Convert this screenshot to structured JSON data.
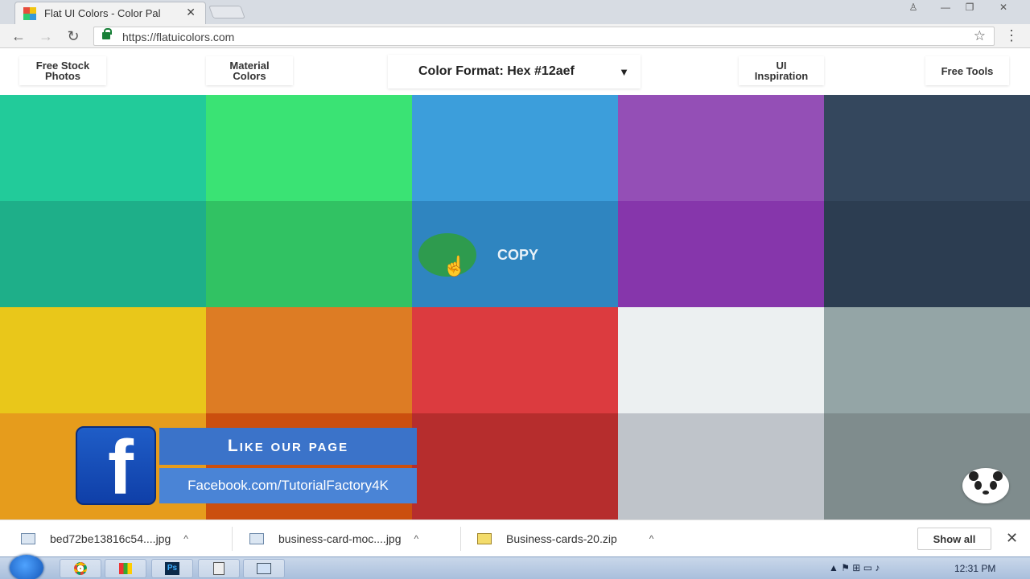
{
  "browser": {
    "tab_title": "Flat UI Colors - Color Pal",
    "tab_close": "✕",
    "url": "https://flatuicolors.com",
    "back": "←",
    "forward": "→",
    "reload": "↻",
    "star": "☆",
    "menu": "⋮",
    "window_controls": [
      "♙",
      "—",
      "❐",
      "✕"
    ]
  },
  "site_nav": {
    "free_stock_photos": [
      "Free Stock",
      "Photos"
    ],
    "material_colors": [
      "Material",
      "Colors"
    ],
    "color_format": "Color Format: Hex #12aef",
    "caret": "▼",
    "ui_inspiration": [
      "UI",
      "Inspiration"
    ],
    "free_tools": "Free Tools"
  },
  "swatches": [
    [
      "#22cb9a",
      "#3ae374",
      "#3c9edb",
      "#944fb6",
      "#34475d"
    ],
    [
      "#1eaf89",
      "#31c263",
      "#2f85c0",
      "#8636ab",
      "#2c3d51"
    ],
    [
      "#e9c71a",
      "#dd7c24",
      "#dc3b3f",
      "#ecf0f1",
      "#94a5a6"
    ],
    [
      "#e69c1c",
      "#cb4f0e",
      "#b62d2d",
      "#bfc4ca",
      "#7f8c8d"
    ]
  ],
  "copy_overlay": {
    "label": "COPY"
  },
  "facebook_banner": {
    "logo_letter": "f",
    "headline": "Like our page",
    "url": "Facebook.com/TutorialFactory4K"
  },
  "downloads": {
    "items": [
      {
        "name": "bed72be13816c54....jpg"
      },
      {
        "name": "business-card-moc....jpg"
      },
      {
        "name": "Business-cards-20.zip"
      }
    ],
    "caret": "^",
    "show_all": "Show all",
    "close": "✕"
  },
  "taskbar": {
    "apps": [
      "",
      "",
      "Ps",
      "",
      ""
    ],
    "tray": "▲  ⚑  ⊞  ▭  ♪",
    "clock": "12:31 PM"
  }
}
